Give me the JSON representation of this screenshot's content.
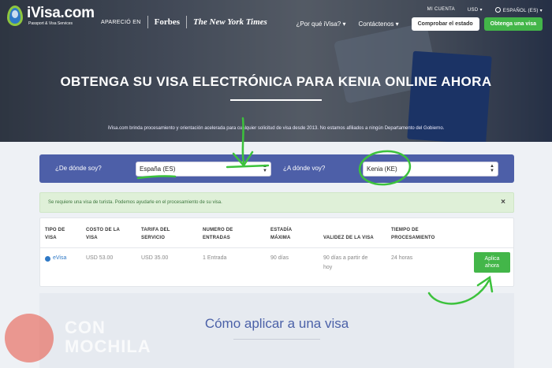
{
  "header": {
    "logo_name": "iVisa.com",
    "logo_tagline": "Passport & Visa Services",
    "press_label": "APARECIÓ EN",
    "press_forbes": "Forbes",
    "press_nyt": "The New York Times",
    "my_account": "MI CUENTA",
    "currency": "USD ▾",
    "language": "ESPAÑOL (ES) ▾",
    "nav_why": "¿Por qué iVisa? ▾",
    "nav_contact": "Contáctenos ▾",
    "check_status": "Comprobar el estado",
    "apply_now": "Obtenga una visa"
  },
  "hero": {
    "title": "OBTENGA SU VISA ELECTRÓNICA PARA KENIA ONLINE AHORA",
    "note": "iVisa.com brinda procesamiento y orientación acelerada para cualquier solicitud de visa desde 2013. No estamos afiliados a ningún Departamento del Gobierno."
  },
  "form": {
    "from_label": "¿De dónde soy?",
    "from_value": "España (ES)",
    "to_label": "¿A dónde voy?",
    "to_value": "Kenia (KE)"
  },
  "alert": {
    "text": "Se requiere una visa de turista. Podemos ayudarle en el procesamiento de su visa.",
    "close": "×"
  },
  "table": {
    "headers": [
      [
        "TIPO DE",
        "VISA"
      ],
      [
        "COSTO DE LA",
        "VISA"
      ],
      [
        "TARIFA DEL",
        "SERVICIO"
      ],
      [
        "NUMERO DE",
        "ENTRADAS"
      ],
      [
        "ESTADÍA",
        "MÁXIMA"
      ],
      [
        "VALIDEZ DE LA VISA",
        ""
      ],
      [
        "TIEMPO DE",
        "PROCESAMIENTO"
      ]
    ],
    "row": {
      "type": "eVisa",
      "cost": "USD 53.00",
      "fee": "USD 35.00",
      "entries": "1 Entrada",
      "stay": "90 días",
      "validity_1": "90 días a partir de",
      "validity_2": "hoy",
      "processing": "24 horas",
      "apply_1": "Aplica",
      "apply_2": "ahora"
    }
  },
  "how": {
    "title": "Cómo aplicar a una visa"
  },
  "watermark": {
    "line1": "CON",
    "line2": "MOCHILA"
  },
  "colors": {
    "primary": "#4d5fa8",
    "green": "#43b649",
    "annotation": "#3cc23c"
  }
}
